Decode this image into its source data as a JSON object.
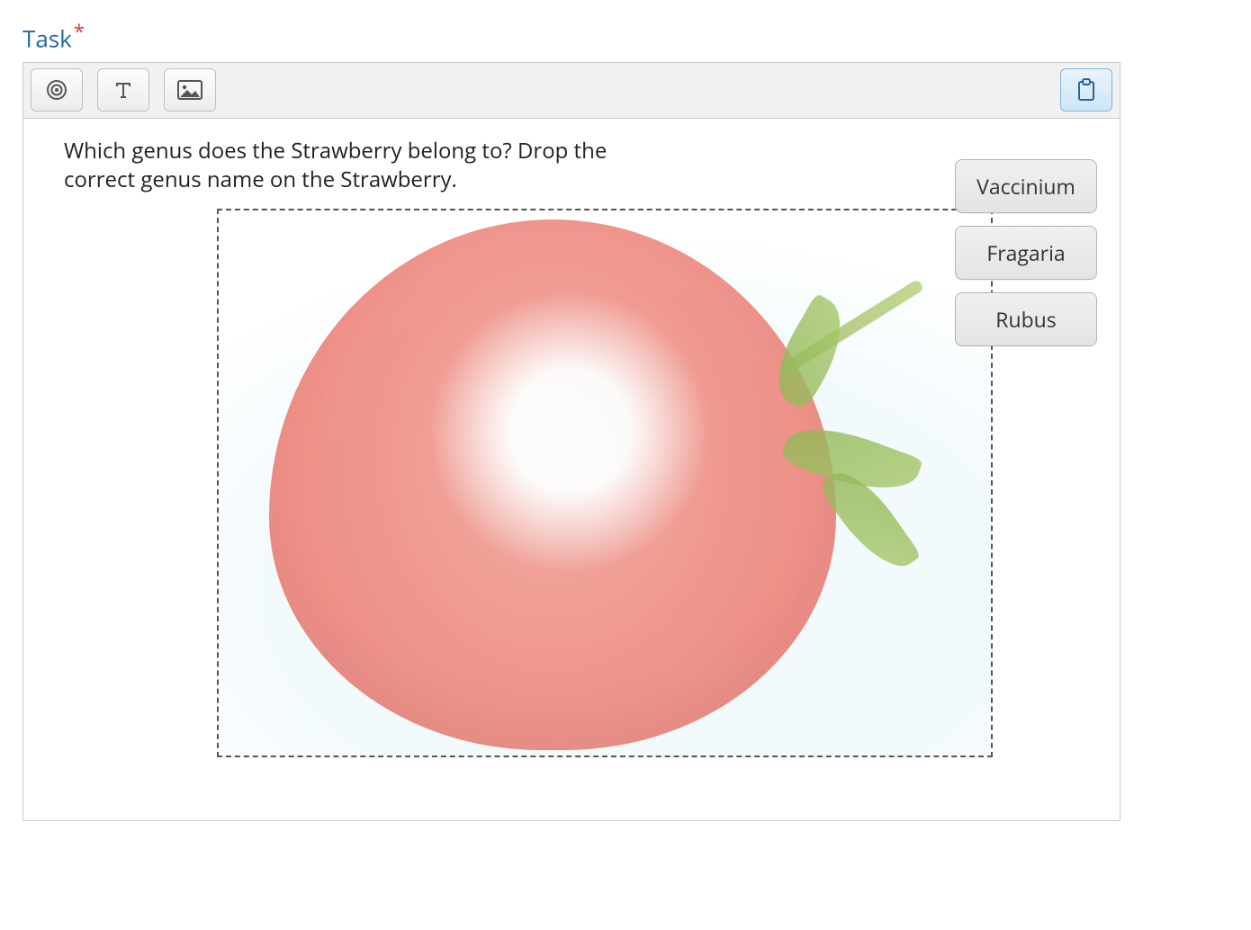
{
  "section": {
    "title": "Task",
    "required_marker": "*"
  },
  "toolbar": {
    "buttons": {
      "target": "target-icon",
      "text": "text-icon",
      "image": "image-icon",
      "clipboard": "clipboard-icon"
    }
  },
  "question": {
    "prompt": "Which genus does the Strawberry belong to? Drop the correct genus name on the Strawberry."
  },
  "drop_zone": {
    "image_description": "Photograph of a halved strawberry with green stem and leaves"
  },
  "drag_options": [
    {
      "label": "Vaccinium"
    },
    {
      "label": "Fragaria"
    },
    {
      "label": "Rubus"
    }
  ],
  "colors": {
    "title": "#1f6aa5",
    "required": "#d9333f",
    "toolbar_bg": "#f1f1f1",
    "panel_border": "#cccccc",
    "active_btn_bg": "#cfe6f8",
    "active_btn_border": "#7fb5e0",
    "drag_item_bg": "#e8e8e8"
  }
}
